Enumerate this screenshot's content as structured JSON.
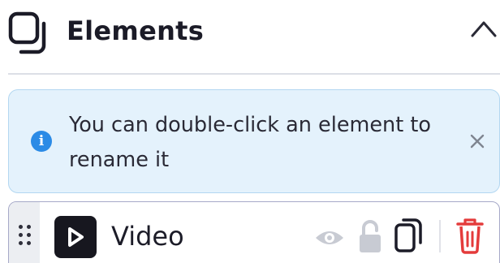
{
  "panel": {
    "title": "Elements",
    "icon": "layers-icon",
    "collapse_icon": "chevron-up-icon"
  },
  "info": {
    "icon": "info-icon",
    "icon_glyph": "i",
    "message": "You can double-click an element to rename it",
    "dismiss_icon": "close-icon"
  },
  "elements": [
    {
      "name": "Video",
      "type_icon": "video-play-icon",
      "actions": [
        "visibility-eye-icon",
        "unlock-icon",
        "duplicate-icon",
        "delete-trash-icon"
      ]
    }
  ],
  "colors": {
    "info_background": "#e4f2fc",
    "info_border": "#b3d7f1",
    "info_icon": "#2b8be6",
    "delete_icon": "#e43b3b",
    "muted_icon": "#c8cbd3",
    "row_border": "#a6a9c8"
  }
}
